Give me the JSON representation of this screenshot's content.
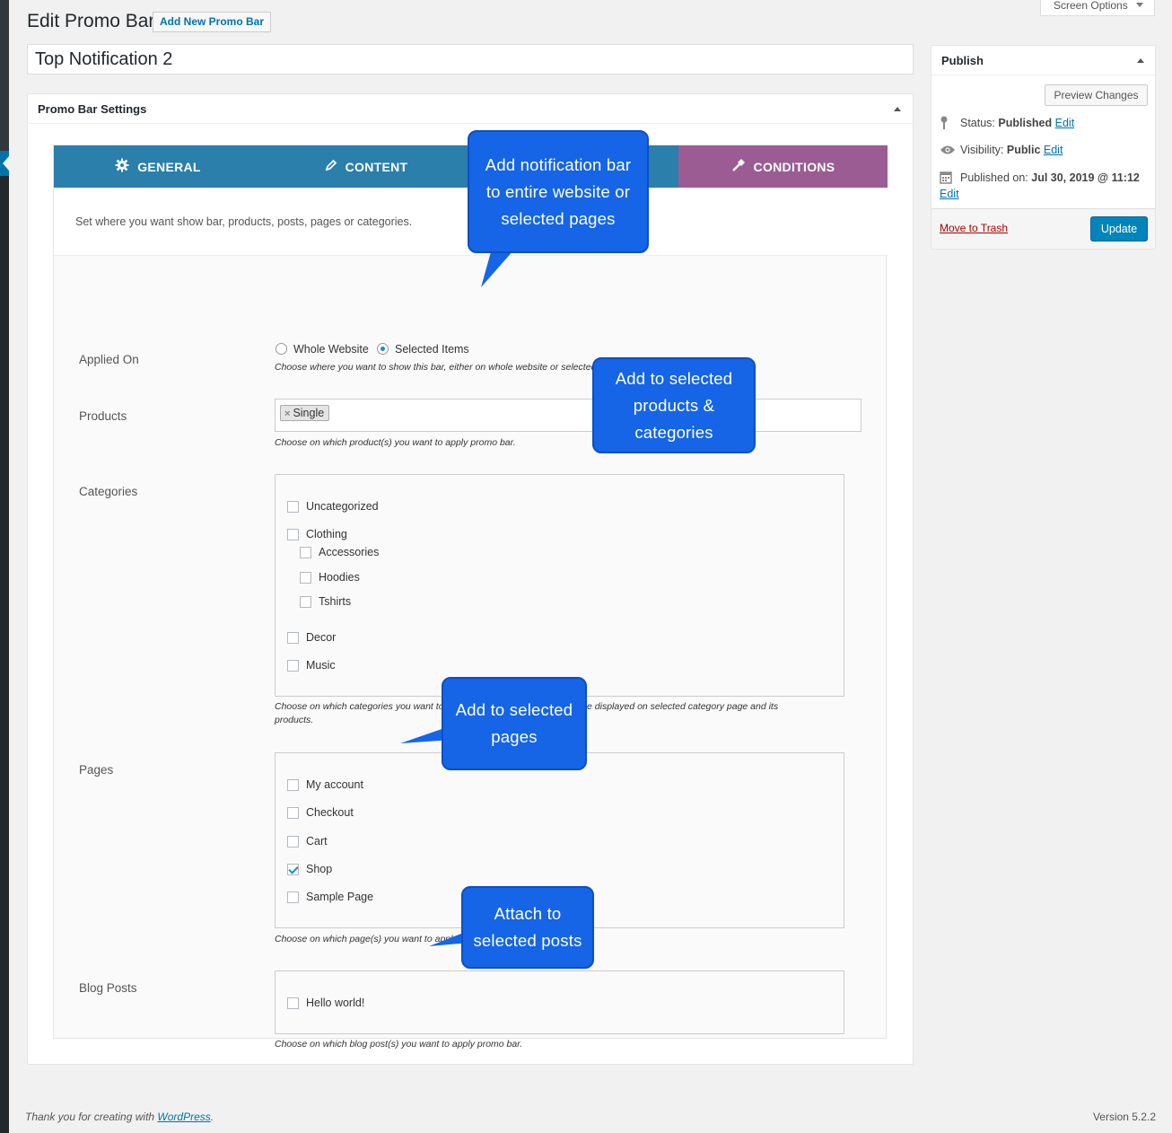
{
  "header": {
    "page_title": "Edit Promo Bar",
    "add_new_label": "Add New Promo Bar",
    "screen_options_label": "Screen Options"
  },
  "post": {
    "title": "Top Notification 2"
  },
  "settings": {
    "box_title": "Promo Bar Settings",
    "tabs": [
      {
        "label": "GENERAL",
        "icon": "gear-icon",
        "color": "#2a7fab"
      },
      {
        "label": "CONTENT",
        "icon": "pencil-icon",
        "color": "#2a7fab"
      },
      {
        "label": "",
        "icon": "",
        "color": "#2a7fab"
      },
      {
        "label": "CONDITIONS",
        "icon": "hammer-icon",
        "color": "#9b5c94"
      }
    ],
    "description": "Set where you want show bar, products, posts, pages or categories.",
    "applied_on": {
      "label": "Applied On",
      "options": [
        "Whole Website",
        "Selected Items"
      ],
      "selected": "Selected Items",
      "help": "Choose where you want to show this bar, either on whole website or selected items."
    },
    "products": {
      "label": "Products",
      "selected": [
        "Single"
      ],
      "help": "Choose on which product(s) you want to apply promo bar."
    },
    "categories": {
      "label": "Categories",
      "items": [
        "Uncategorized",
        "Clothing",
        "Accessories",
        "Hoodies",
        "Tshirts",
        "Decor",
        "Music"
      ],
      "help_line1": "Choose on which categories you want to apply promo bar. Promo bar will be displayed on selected category page and its",
      "help_line2": "products."
    },
    "pages": {
      "label": "Pages",
      "items": [
        "My account",
        "Checkout",
        "Cart",
        "Shop",
        "Sample Page"
      ],
      "checked": [
        "Shop"
      ],
      "help": "Choose on which page(s) you want to apply promo bar."
    },
    "blog_posts": {
      "label": "Blog Posts",
      "items": [
        "Hello world!"
      ],
      "help": "Choose on which blog post(s) you want to apply promo bar."
    }
  },
  "callouts": {
    "notification": [
      "Add notification bar",
      "to entire website or",
      "selected pages"
    ],
    "products": [
      "Add to selected",
      "products &",
      "categories"
    ],
    "pages": [
      "Add to selected",
      "pages"
    ],
    "posts": [
      "Attach to",
      "selected posts"
    ]
  },
  "publish": {
    "title": "Publish",
    "preview_label": "Preview Changes",
    "status_label": "Status:",
    "status_value": "Published",
    "visibility_label": "Visibility:",
    "visibility_value": "Public",
    "published_label": "Published on:",
    "published_value": "Jul 30, 2019 @ 11:12",
    "edit_label": "Edit",
    "trash_label": "Move to Trash",
    "update_label": "Update"
  },
  "footer": {
    "thanks_prefix": "Thank you for creating with ",
    "thanks_link": "WordPress",
    "thanks_suffix": ".",
    "version": "Version 5.2.2"
  }
}
